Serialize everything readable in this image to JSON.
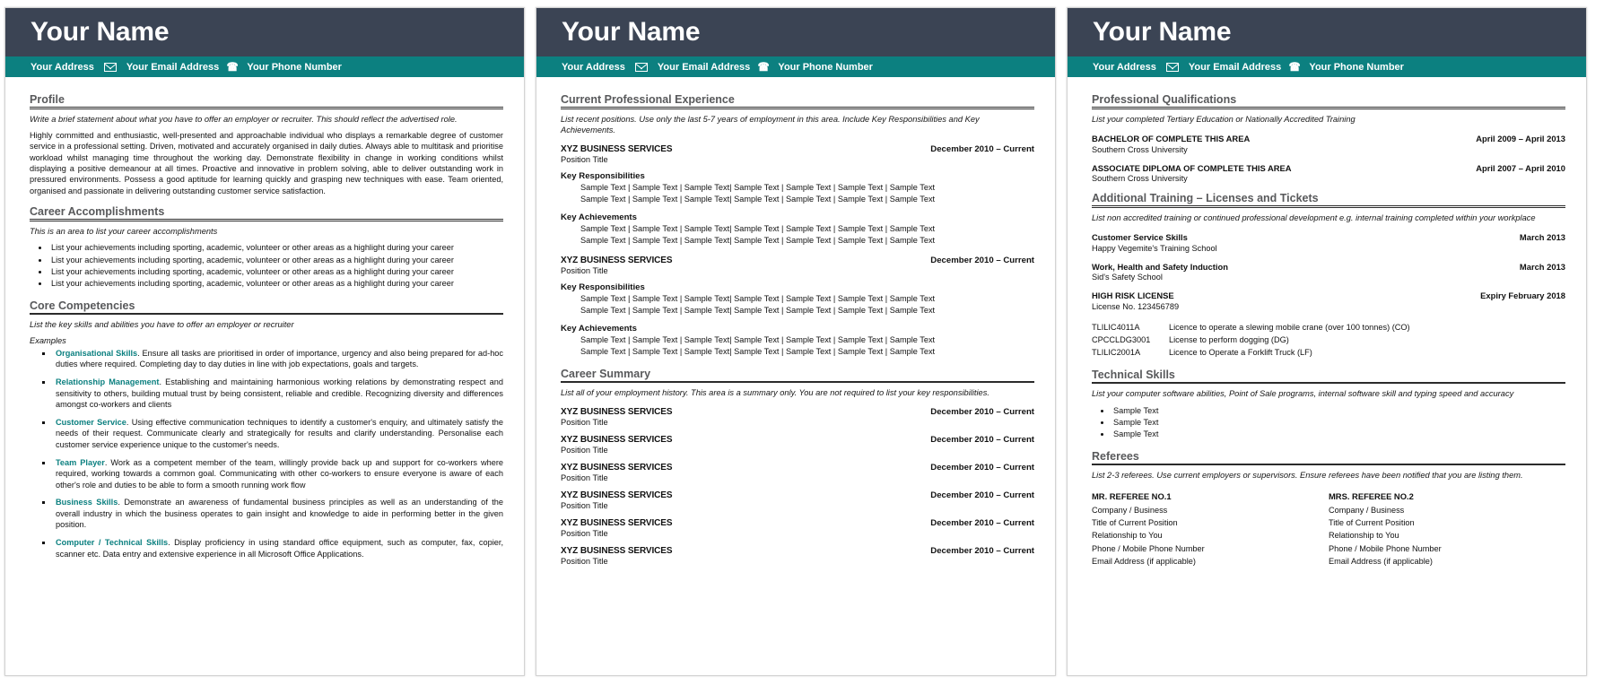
{
  "header": {
    "name": "Your Name",
    "address": "Your Address",
    "email": "Your Email Address",
    "phone": "Your Phone Number",
    "email_icon": "envelope-icon",
    "phone_icon": "phone-icon",
    "name_bar_color": "#3b4454",
    "contact_bar_color": "#0c8080",
    "accent_color": "#0c8080"
  },
  "page1": {
    "profile": {
      "title": "Profile",
      "hint": "Write a brief statement about what you have to offer an employer or recruiter.  This should reflect the advertised role.",
      "body": "Highly committed and enthusiastic, well-presented and approachable individual who displays a remarkable degree of customer service in a professional setting. Driven, motivated and accurately organised in daily duties. Always able to multitask and prioritise workload whilst managing time throughout the working day. Demonstrate flexibility in change in working conditions whilst displaying a positive demeanour at all times. Proactive and innovative in problem solving, able to deliver outstanding work in pressured environments. Possess a good aptitude for learning quickly and grasping new techniques with ease. Team oriented, organised and passionate in delivering outstanding customer service satisfaction."
    },
    "career_accomplishments": {
      "title": "Career Accomplishments",
      "hint": "This is an area to list your career accomplishments",
      "bullets": [
        "List your achievements including sporting, academic, volunteer or other areas as a highlight during your career",
        "List your achievements including sporting, academic, volunteer or other areas as a highlight during your career",
        "List your achievements including sporting, academic, volunteer or other areas as a highlight during your career",
        "List your achievements including sporting, academic, volunteer or other areas as a highlight during your career"
      ]
    },
    "core_competencies": {
      "title": "Core Competencies",
      "hint": "List the key skills and abilities you have to offer an employer or recruiter",
      "examples_label": "Examples",
      "items": [
        {
          "skill": "Organisational Skills",
          "text": ". Ensure all tasks are prioritised in order of importance, urgency and also being prepared for ad-hoc duties where required. Completing day to day duties in line with job expectations, goals and targets."
        },
        {
          "skill": "Relationship Management",
          "text": ". Establishing and maintaining harmonious working relations by demonstrating respect and sensitivity to others, building mutual trust by being consistent, reliable and credible. Recognizing diversity and differences amongst co-workers and clients"
        },
        {
          "skill": "Customer Service",
          "text": ". Using effective communication techniques to identify a customer's enquiry, and ultimately satisfy the needs of their request. Communicate clearly and strategically for results and clarify understanding. Personalise each customer service experience unique to the customer's needs."
        },
        {
          "skill": "Team Player",
          "text": ". Work as a competent member of the team, willingly provide back up and support for co-workers where required, working towards a common goal. Communicating with other co-workers to ensure everyone is aware of each other's role and duties to be able to form a smooth running work flow"
        },
        {
          "skill": "Business Skills",
          "text": ". Demonstrate an awareness of fundamental business principles as well as an understanding of the overall industry in which the business operates to gain insight and knowledge to aide in performing better in the given position."
        },
        {
          "skill": "Computer / Technical Skills",
          "text": ". Display proficiency in using standard office equipment, such as computer, fax, copier, scanner etc. Data entry and extensive experience in all Microsoft Office Applications."
        }
      ]
    }
  },
  "page2": {
    "current_experience": {
      "title": "Current Professional Experience",
      "hint": "List recent positions. Use only the last 5-7 years of employment in this area. Include Key Responsibilities and Key Achievements.",
      "sample_line": "Sample Text | Sample Text | Sample Text| Sample Text | Sample Text | Sample Text | Sample Text",
      "responsibilities_label": "Key Responsibilities",
      "achievements_label": "Key Achievements",
      "jobs": [
        {
          "company": "XYZ BUSINESS SERVICES",
          "date": "December 2010 – Current",
          "position": "Position Title",
          "responsibilities": [
            "Sample Text | Sample Text | Sample Text| Sample Text | Sample Text | Sample Text | Sample Text",
            "Sample Text | Sample Text | Sample Text| Sample Text | Sample Text | Sample Text | Sample Text"
          ],
          "achievements": [
            "Sample Text | Sample Text | Sample Text| Sample Text | Sample Text | Sample Text | Sample Text",
            "Sample Text | Sample Text | Sample Text| Sample Text | Sample Text | Sample Text | Sample Text"
          ]
        },
        {
          "company": "XYZ BUSINESS SERVICES",
          "date": "December 2010 – Current",
          "position": "Position Title",
          "responsibilities": [
            "Sample Text | Sample Text | Sample Text| Sample Text | Sample Text | Sample Text | Sample Text",
            "Sample Text | Sample Text | Sample Text| Sample Text | Sample Text | Sample Text | Sample Text"
          ],
          "achievements": [
            "Sample Text | Sample Text | Sample Text| Sample Text | Sample Text | Sample Text | Sample Text",
            "Sample Text | Sample Text | Sample Text| Sample Text | Sample Text | Sample Text | Sample Text"
          ]
        }
      ]
    },
    "career_summary": {
      "title": "Career Summary",
      "hint": "List all of your employment history. This area is a summary only.  You are not required to list your key responsibilities.",
      "jobs": [
        {
          "company": "XYZ BUSINESS SERVICES",
          "date": "December 2010 – Current",
          "position": "Position Title"
        },
        {
          "company": "XYZ BUSINESS SERVICES",
          "date": "December 2010 – Current",
          "position": "Position Title"
        },
        {
          "company": "XYZ BUSINESS SERVICES",
          "date": "December 2010 – Current",
          "position": "Position Title"
        },
        {
          "company": "XYZ BUSINESS SERVICES",
          "date": "December 2010 – Current",
          "position": "Position Title"
        },
        {
          "company": "XYZ BUSINESS SERVICES",
          "date": "December 2010 – Current",
          "position": "Position Title"
        },
        {
          "company": "XYZ BUSINESS SERVICES",
          "date": "December 2010 – Current",
          "position": "Position Title"
        }
      ]
    }
  },
  "page3": {
    "professional_qualifications": {
      "title": "Professional Qualifications",
      "hint": "List your completed Tertiary Education or Nationally Accredited Training",
      "entries": [
        {
          "name": "BACHELOR OF COMPLETE THIS AREA",
          "date": "April 2009 – April 2013",
          "org": "Southern Cross University"
        },
        {
          "name": "ASSOCIATE DIPLOMA OF COMPLETE THIS AREA",
          "date": "April 2007 – April 2010",
          "org": "Southern Cross University"
        }
      ]
    },
    "additional_training": {
      "title": "Additional Training – Licenses and Tickets",
      "hint": "List non accredited training or continued professional development e.g. internal training completed within your workplace",
      "entries": [
        {
          "name": "Customer Service Skills",
          "date": "March 2013",
          "org": "Happy Vegemite's Training School"
        },
        {
          "name": "Work, Health and Safety Induction",
          "date": "March 2013",
          "org": "Sid's Safety School"
        },
        {
          "name": "HIGH RISK LICENSE",
          "date": "Expiry February 2018",
          "org": "License No. 123456789"
        }
      ],
      "licenses": [
        {
          "code": "TLILIC4011A",
          "desc": "Licence to operate a slewing mobile crane (over 100 tonnes) (CO)"
        },
        {
          "code": "CPCCLDG3001",
          "desc": "License to perform dogging (DG)"
        },
        {
          "code": "TLILIC2001A",
          "desc": "Licence to Operate a Forklift Truck (LF)"
        }
      ]
    },
    "technical_skills": {
      "title": "Technical Skills",
      "hint": "List your computer software abilities, Point of Sale programs, internal software skill and typing speed and accuracy",
      "bullets": [
        "Sample Text",
        "Sample Text",
        "Sample Text"
      ]
    },
    "referees": {
      "title": "Referees",
      "hint": "List 2-3 referees. Use current employers or supervisors. Ensure referees have been notified that you are listing them.",
      "list": [
        {
          "name": "MR. REFEREE NO.1",
          "lines": [
            "Company / Business",
            "Title of Current Position",
            "Relationship to You",
            "Phone / Mobile Phone Number",
            "Email Address (if applicable)"
          ]
        },
        {
          "name": "MRS. REFEREE NO.2",
          "lines": [
            "Company / Business",
            "Title of Current Position",
            "Relationship to You",
            "Phone / Mobile Phone Number",
            "Email Address (if applicable)"
          ]
        }
      ]
    }
  }
}
